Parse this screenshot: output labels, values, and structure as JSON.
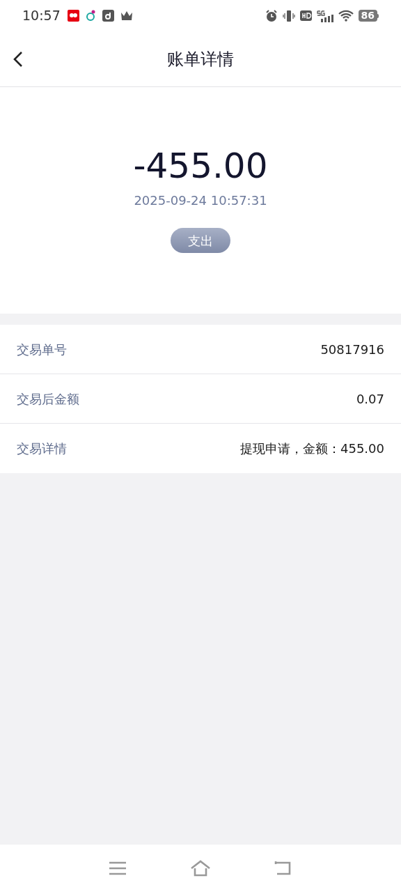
{
  "status_bar": {
    "time": "10:57",
    "battery": "86"
  },
  "header": {
    "title": "账单详情"
  },
  "summary": {
    "amount": "-455.00",
    "datetime": "2025-09-24 10:57:31",
    "tag": "支出"
  },
  "details": [
    {
      "label": "交易单号",
      "value": "50817916"
    },
    {
      "label": "交易后金额",
      "value": "0.07"
    },
    {
      "label": "交易详情",
      "value": "提现申请，金额：455.00"
    }
  ]
}
